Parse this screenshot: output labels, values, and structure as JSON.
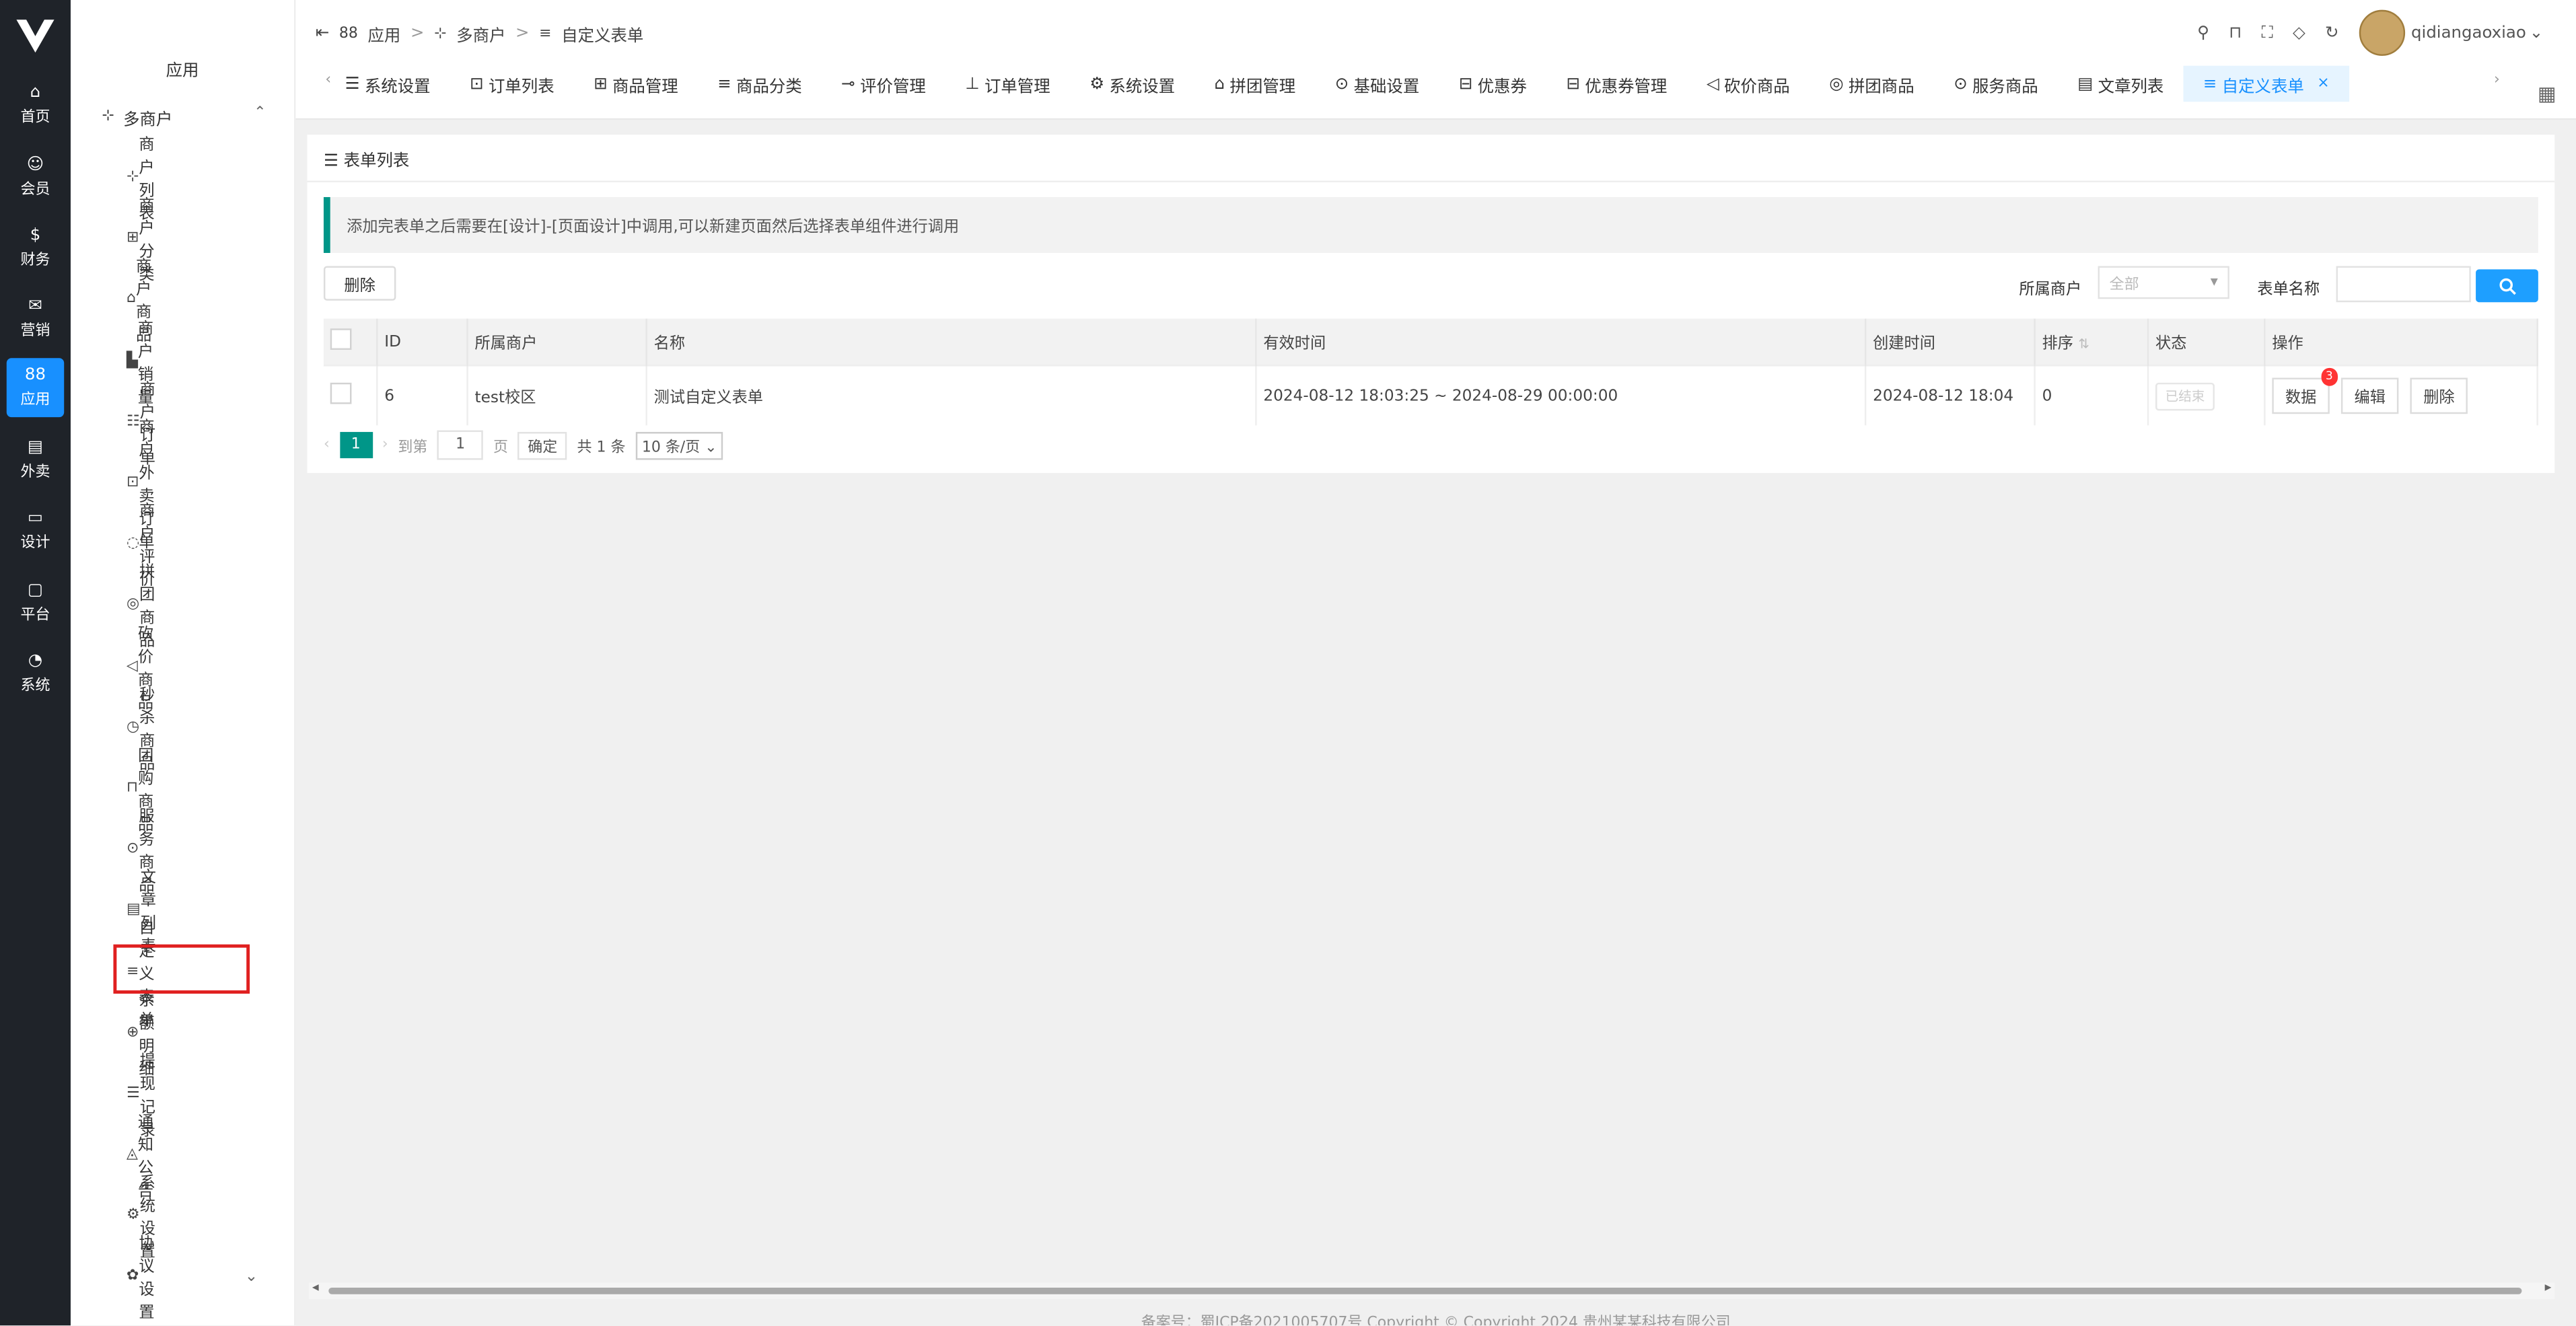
{
  "rail": [
    {
      "label": "首页",
      "icon": "home-icon",
      "glyph": "⌂"
    },
    {
      "label": "会员",
      "icon": "user-icon",
      "glyph": "☺"
    },
    {
      "label": "财务",
      "icon": "finance-icon",
      "glyph": "$"
    },
    {
      "label": "营销",
      "icon": "marketing-icon",
      "glyph": "✉"
    },
    {
      "label": "应用",
      "icon": "apps-icon",
      "glyph": "88",
      "active": true
    },
    {
      "label": "外卖",
      "icon": "takeout-icon",
      "glyph": "▤"
    },
    {
      "label": "设计",
      "icon": "design-icon",
      "glyph": "▭"
    },
    {
      "label": "平台",
      "icon": "platform-icon",
      "glyph": "▢"
    },
    {
      "label": "系统",
      "icon": "system-icon",
      "glyph": "◔"
    }
  ],
  "sidebar": {
    "header": "应用",
    "group": "多商户",
    "items": [
      {
        "label": "商户列表",
        "glyph": "⊹"
      },
      {
        "label": "商户分类",
        "glyph": "⊞"
      },
      {
        "label": "商户商品",
        "glyph": "⌂"
      },
      {
        "label": "商户销量",
        "glyph": "▙"
      },
      {
        "label": "商户订单",
        "glyph": "☷"
      },
      {
        "label": "商户外卖订单",
        "glyph": "⊡"
      },
      {
        "label": "商户评价",
        "glyph": "◌"
      },
      {
        "label": "拼团商品",
        "glyph": "◎"
      },
      {
        "label": "砍价商品",
        "glyph": "◁"
      },
      {
        "label": "秒杀商品",
        "glyph": "◷"
      },
      {
        "label": "团购商品",
        "glyph": "⊓"
      },
      {
        "label": "服务商品",
        "glyph": "⊙"
      },
      {
        "label": "文章列表",
        "glyph": "▤"
      },
      {
        "label": "自定义表单",
        "glyph": "≡"
      },
      {
        "label": "余额明细",
        "glyph": "⊕"
      },
      {
        "label": "提现记录",
        "glyph": "☰"
      },
      {
        "label": "通知公告",
        "glyph": "◬"
      },
      {
        "label": "系统设置",
        "glyph": "⚙"
      },
      {
        "label": "协议设置",
        "glyph": "✿"
      }
    ]
  },
  "breadcrumb": {
    "c1": "应用",
    "c2": "多商户",
    "c3": "自定义表单",
    "sep": ">"
  },
  "user": {
    "name": "qidiangaoxiao"
  },
  "tabs": [
    {
      "label": "系统设置",
      "glyph": "☰"
    },
    {
      "label": "订单列表",
      "glyph": "⊡"
    },
    {
      "label": "商品管理",
      "glyph": "⊞"
    },
    {
      "label": "商品分类",
      "glyph": "≡"
    },
    {
      "label": "评价管理",
      "glyph": "⊸"
    },
    {
      "label": "订单管理",
      "glyph": "⊥"
    },
    {
      "label": "系统设置",
      "glyph": "⚙"
    },
    {
      "label": "拼团管理",
      "glyph": "⌂"
    },
    {
      "label": "基础设置",
      "glyph": "⊙"
    },
    {
      "label": "优惠券",
      "glyph": "⊟"
    },
    {
      "label": "优惠券管理",
      "glyph": "⊟"
    },
    {
      "label": "砍价商品",
      "glyph": "◁"
    },
    {
      "label": "拼团商品",
      "glyph": "◎"
    },
    {
      "label": "服务商品",
      "glyph": "⊙"
    },
    {
      "label": "文章列表",
      "glyph": "▤"
    },
    {
      "label": "自定义表单",
      "glyph": "≡",
      "active": true
    }
  ],
  "card": {
    "title": "表单列表",
    "alert": "添加完表单之后需要在[设计]-[页面设计]中调用,可以新建页面然后选择表单组件进行调用",
    "delete_btn": "删除",
    "filter_merchant_label": "所属商户",
    "filter_merchant_value": "全部",
    "filter_name_label": "表单名称"
  },
  "table": {
    "headers": [
      "ID",
      "所属商户",
      "名称",
      "有效时间",
      "创建时间",
      "排序",
      "状态",
      "操作"
    ],
    "rows": [
      {
        "id": "6",
        "merchant": "test校区",
        "name": "测试自定义表单",
        "valid": "2024-08-12 18:03:25 ~ 2024-08-29 00:00:00",
        "created": "2024-08-12 18:04",
        "sort": "0",
        "status": "已结束",
        "ops": {
          "data": "数据",
          "badge": "3",
          "edit": "编辑",
          "del": "删除"
        }
      }
    ]
  },
  "pager": {
    "current": "1",
    "goto_prefix": "到第",
    "goto_value": "1",
    "goto_suffix": "页",
    "confirm": "确定",
    "total": "共 1 条",
    "per_page": "10 条/页"
  },
  "footer": "备案号：蜀ICP备2021005707号 Copyright © Copyright 2024 贵州某某科技有限公司"
}
